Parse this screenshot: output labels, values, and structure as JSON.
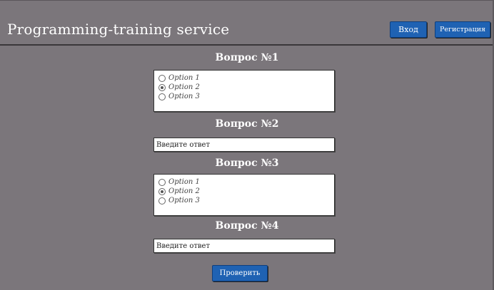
{
  "header": {
    "title": "Programming-training service",
    "login_label": "Вход",
    "register_label": "Регистрация"
  },
  "questions": [
    {
      "title": "Вопрос №1",
      "type": "radio",
      "options": [
        {
          "label": "Option 1",
          "selected": false
        },
        {
          "label": "Option 2",
          "selected": true
        },
        {
          "label": "Option 3",
          "selected": false
        }
      ]
    },
    {
      "title": "Вопрос №2",
      "type": "text",
      "placeholder": "Введите ответ"
    },
    {
      "title": "Вопрос №3",
      "type": "radio",
      "options": [
        {
          "label": "Option 1",
          "selected": false
        },
        {
          "label": "Option 2",
          "selected": true
        },
        {
          "label": "Option 3",
          "selected": false
        }
      ]
    },
    {
      "title": "Вопрос №4",
      "type": "text",
      "placeholder": "Введите ответ"
    }
  ],
  "submit_label": "Проверить",
  "colors": {
    "background": "#7b767b",
    "button": "#1f62b3"
  }
}
